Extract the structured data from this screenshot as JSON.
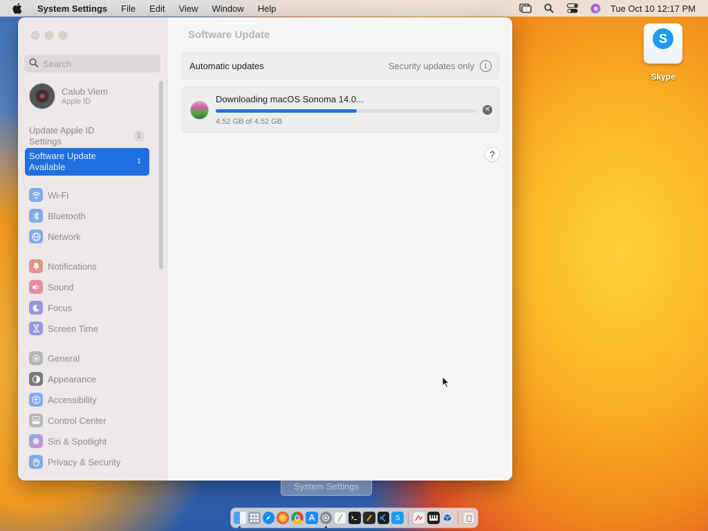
{
  "menubar": {
    "app_name": "System Settings",
    "menus": [
      "File",
      "Edit",
      "View",
      "Window",
      "Help"
    ],
    "clock": "Tue Oct 10  12:17 PM"
  },
  "desktop": {
    "icons": [
      {
        "label": "Skype",
        "icon": "skype-icon"
      }
    ]
  },
  "sidebar": {
    "search_placeholder": "Search",
    "account": {
      "name": "Calub Viem",
      "subtitle": "Apple ID"
    },
    "alerts": [
      {
        "label": "Update Apple ID Settings",
        "badge": "1"
      },
      {
        "label": "Software Update Available",
        "badge": "1",
        "selected": true
      }
    ],
    "items": [
      {
        "label": "Wi-Fi",
        "icon": "wifi-icon",
        "color": "#2a7be8"
      },
      {
        "label": "Bluetooth",
        "icon": "bluetooth-icon",
        "color": "#2a7be8"
      },
      {
        "label": "Network",
        "icon": "globe-icon",
        "color": "#2a7be8"
      },
      {
        "label": "Notifications",
        "icon": "bell-icon",
        "color": "#e5473f"
      },
      {
        "label": "Sound",
        "icon": "speaker-icon",
        "color": "#e0426a"
      },
      {
        "label": "Focus",
        "icon": "moon-icon",
        "color": "#5b52d6"
      },
      {
        "label": "Screen Time",
        "icon": "hourglass-icon",
        "color": "#5b52d6"
      },
      {
        "label": "General",
        "icon": "gear-icon",
        "color": "#8e8e93"
      },
      {
        "label": "Appearance",
        "icon": "appearance-icon",
        "color": "#1c1c1e"
      },
      {
        "label": "Accessibility",
        "icon": "accessibility-icon",
        "color": "#2a7be8"
      },
      {
        "label": "Control Center",
        "icon": "control-center-icon",
        "color": "#8e8e93"
      },
      {
        "label": "Siri & Spotlight",
        "icon": "siri-icon",
        "color": "#c13ec9"
      },
      {
        "label": "Privacy & Security",
        "icon": "hand-icon",
        "color": "#2a7be8"
      }
    ]
  },
  "main": {
    "title": "Software Update",
    "automatic_updates": {
      "label": "Automatic updates",
      "value": "Security updates only"
    },
    "download": {
      "title": "Downloading macOS Sonoma 14.0...",
      "progress": 0.54,
      "size_text": "4.52 GB of 4.52 GB"
    },
    "help_label": "?"
  },
  "ghost_tooltip": "System Settings",
  "colors": {
    "accent": "#1f6fe0"
  }
}
